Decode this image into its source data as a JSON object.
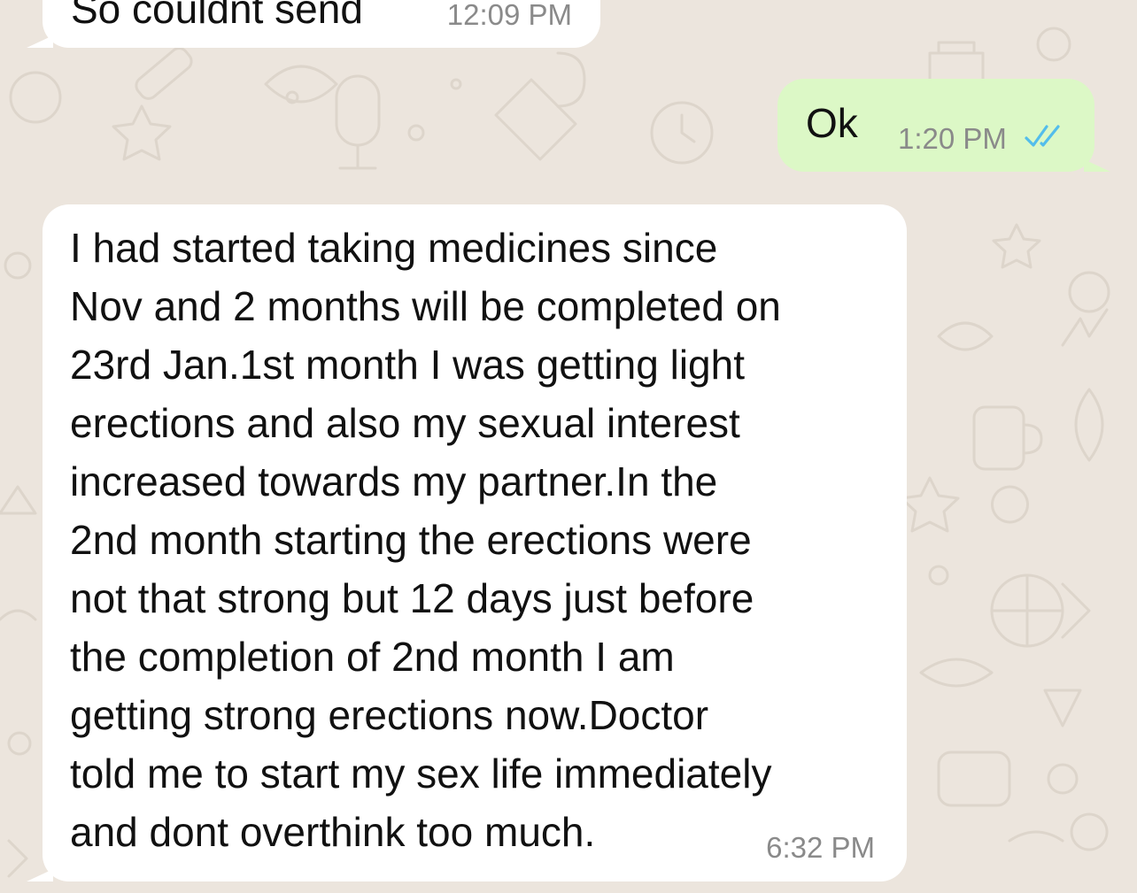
{
  "chat": {
    "background_color": "#ece5dd",
    "incoming_bubble_color": "#ffffff",
    "outgoing_bubble_color": "#dcf8c6",
    "read_receipt_color": "#53bdeb",
    "messages": [
      {
        "direction": "incoming",
        "text": "So couldnt send",
        "time": "12:09 PM"
      },
      {
        "direction": "outgoing",
        "text": "Ok",
        "time": "1:20 PM",
        "status_icon": "double-check-read-icon"
      },
      {
        "direction": "incoming",
        "text": "I had started taking medicines since\nNov and 2 months will be completed on\n23rd Jan.1st month I was getting light\nerections and also my sexual interest\nincreased towards my partner.In the\n2nd month starting the erections were\nnot that strong but 12 days just before\nthe completion of 2nd month I am\ngetting strong erections now.Doctor\ntold me to start my sex life immediately\nand dont overthink too much.",
        "time": "6:32 PM"
      }
    ]
  }
}
